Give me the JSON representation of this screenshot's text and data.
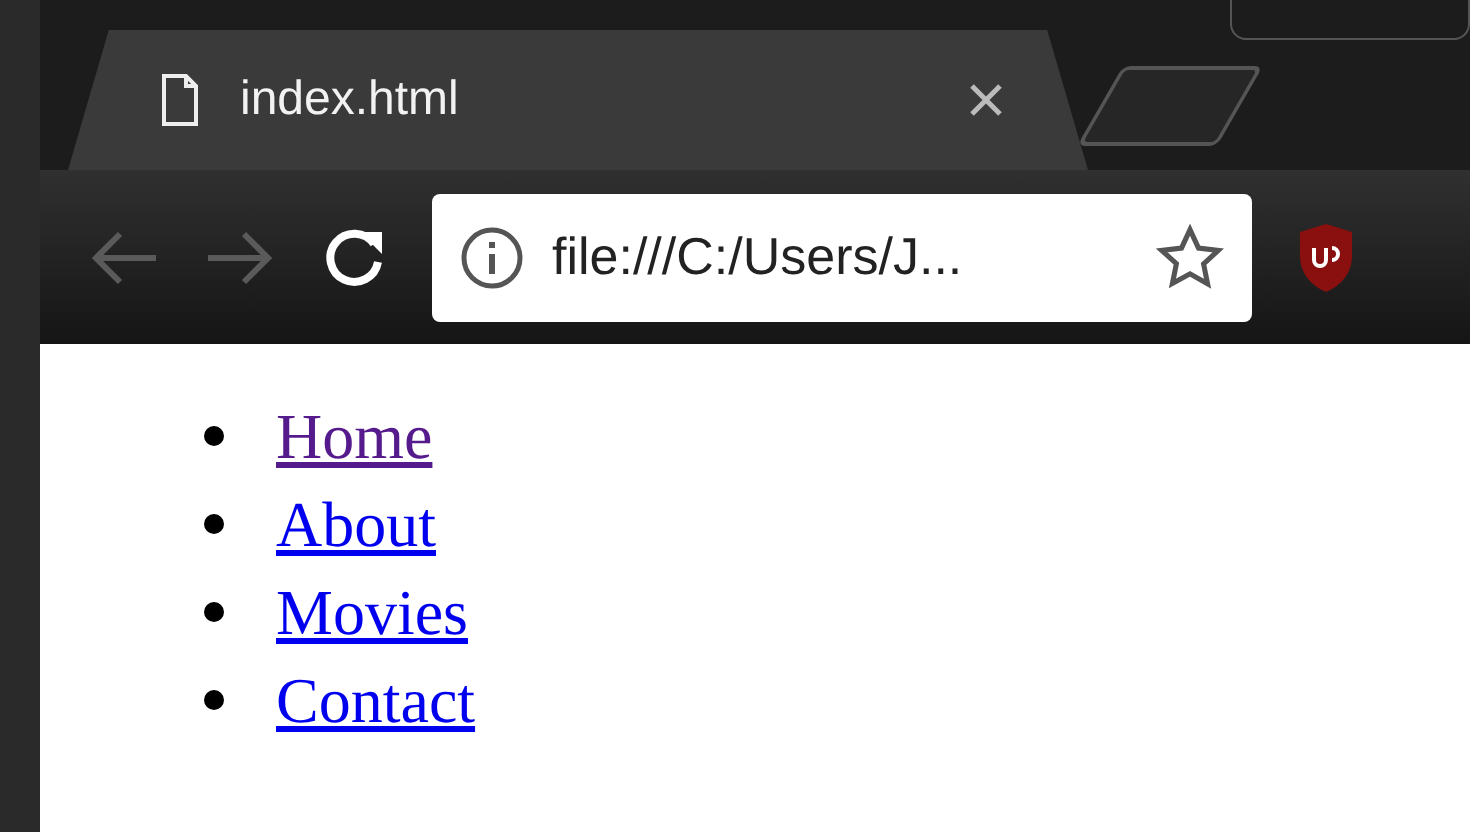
{
  "tab": {
    "title": "index.html",
    "selected": true
  },
  "toolbar": {
    "back_disabled": true,
    "forward_disabled": true,
    "address": "file:///C:/Users/J..."
  },
  "nav_links": [
    {
      "label": "Home",
      "visited": true
    },
    {
      "label": "About",
      "visited": false
    },
    {
      "label": "Movies",
      "visited": false
    },
    {
      "label": "Contact",
      "visited": false
    }
  ]
}
